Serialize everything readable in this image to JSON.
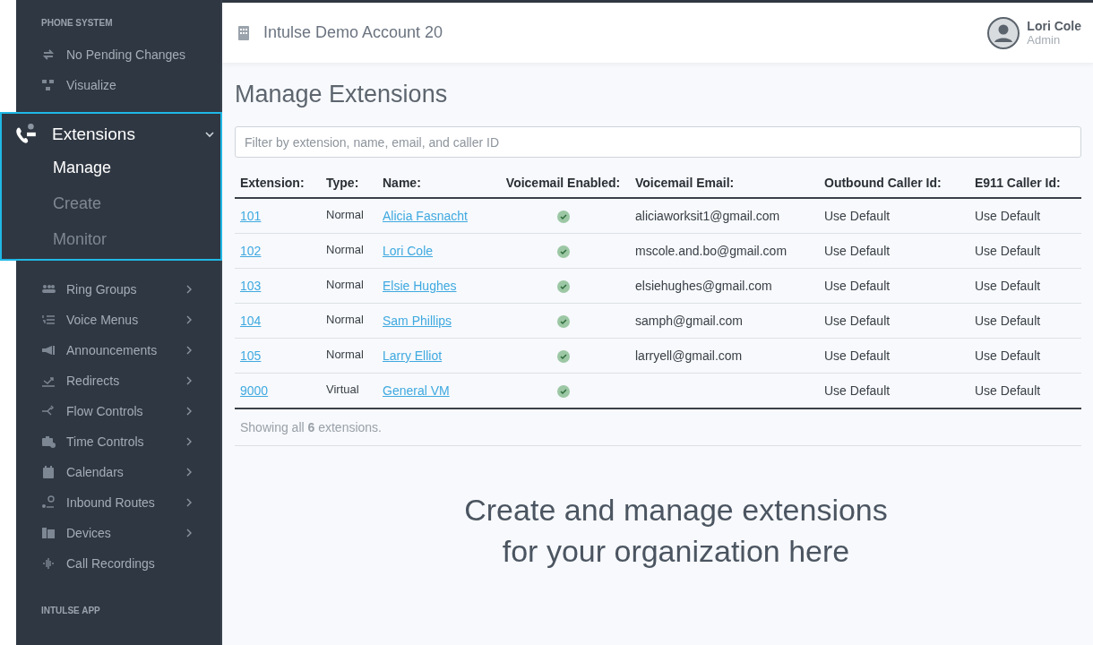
{
  "sidebar": {
    "section_title": "PHONE SYSTEM",
    "top_items": [
      {
        "label": "No Pending Changes",
        "has_submenu": false
      },
      {
        "label": "Visualize",
        "has_submenu": false
      }
    ],
    "extensions_menu": {
      "label": "Extensions",
      "expanded": true,
      "items": [
        {
          "label": "Manage",
          "selected": true
        },
        {
          "label": "Create",
          "selected": false
        },
        {
          "label": "Monitor",
          "selected": false
        }
      ]
    },
    "items": [
      {
        "label": "Ring Groups",
        "has_submenu": true
      },
      {
        "label": "Voice Menus",
        "has_submenu": true
      },
      {
        "label": "Announcements",
        "has_submenu": true
      },
      {
        "label": "Redirects",
        "has_submenu": true
      },
      {
        "label": "Flow Controls",
        "has_submenu": true
      },
      {
        "label": "Time Controls",
        "has_submenu": true
      },
      {
        "label": "Calendars",
        "has_submenu": true
      },
      {
        "label": "Inbound Routes",
        "has_submenu": true
      },
      {
        "label": "Devices",
        "has_submenu": true
      },
      {
        "label": "Call Recordings",
        "has_submenu": false
      }
    ],
    "footer_section_title": "INTULSE APP"
  },
  "header": {
    "account": "Intulse Demo Account 20",
    "user_name": "Lori Cole",
    "user_role": "Admin"
  },
  "page_title": "Manage Extensions",
  "filter": {
    "placeholder": "Filter by extension, name, email, and caller ID"
  },
  "table": {
    "columns": [
      "Extension:",
      "Type:",
      "Name:",
      "Voicemail Enabled:",
      "Voicemail Email:",
      "Outbound Caller Id:",
      "E911 Caller Id:"
    ],
    "rows": [
      {
        "extension": "101",
        "type": "Normal",
        "name": "Alicia Fasnacht",
        "voicemail_enabled": true,
        "email": "aliciaworksit1@gmail.com",
        "outbound": "Use Default",
        "e911": "Use Default"
      },
      {
        "extension": "102",
        "type": "Normal",
        "name": "Lori Cole",
        "voicemail_enabled": true,
        "email": "mscole.and.bo@gmail.com",
        "outbound": "Use Default",
        "e911": "Use Default"
      },
      {
        "extension": "103",
        "type": "Normal",
        "name": "Elsie Hughes",
        "voicemail_enabled": true,
        "email": "elsiehughes@gmail.com",
        "outbound": "Use Default",
        "e911": "Use Default"
      },
      {
        "extension": "104",
        "type": "Normal",
        "name": "Sam Phillips",
        "voicemail_enabled": true,
        "email": "samph@gmail.com",
        "outbound": "Use Default",
        "e911": "Use Default"
      },
      {
        "extension": "105",
        "type": "Normal",
        "name": "Larry Elliot",
        "voicemail_enabled": true,
        "email": "larryell@gmail.com",
        "outbound": "Use Default",
        "e911": "Use Default"
      },
      {
        "extension": "9000",
        "type": "Virtual",
        "name": "General VM",
        "voicemail_enabled": true,
        "outbound": "Use Default",
        "e911": "Use Default"
      }
    ],
    "summary": "Showing all **6** extensions."
  },
  "caption": "Create and manage extensions for your organization here"
}
